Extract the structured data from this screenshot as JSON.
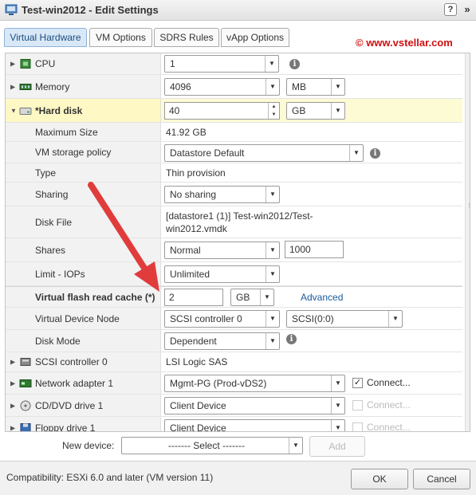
{
  "window": {
    "title": "Test-win2012 - Edit Settings",
    "help": "?",
    "more": "»"
  },
  "tabs": [
    "Virtual Hardware",
    "VM Options",
    "SDRS Rules",
    "vApp Options"
  ],
  "watermark": "© www.vstellar.com",
  "rows": {
    "cpu": {
      "label": "CPU",
      "value": "1"
    },
    "memory": {
      "label": "Memory",
      "value": "4096",
      "unit": "MB"
    },
    "harddisk": {
      "label": "*Hard disk",
      "value": "40",
      "unit": "GB"
    },
    "maxsize": {
      "label": "Maximum Size",
      "value": "41.92 GB"
    },
    "policy": {
      "label": "VM storage policy",
      "value": "Datastore Default"
    },
    "type": {
      "label": "Type",
      "value": "Thin provision"
    },
    "sharing": {
      "label": "Sharing",
      "value": "No sharing"
    },
    "diskfile": {
      "label": "Disk File",
      "line1": "[datastore1 (1)] Test-win2012/Test-",
      "line2": "win2012.vmdk"
    },
    "shares": {
      "label": "Shares",
      "value": "Normal",
      "amount": "1000"
    },
    "limit": {
      "label": "Limit - IOPs",
      "value": "Unlimited"
    },
    "vflash": {
      "label": "Virtual flash read cache (*)",
      "value": "2",
      "unit": "GB",
      "link": "Advanced"
    },
    "vdn": {
      "label": "Virtual Device Node",
      "controller": "SCSI controller 0",
      "node": "SCSI(0:0)"
    },
    "diskmode": {
      "label": "Disk Mode",
      "value": "Dependent"
    },
    "scsi": {
      "label": "SCSI controller 0",
      "value": "LSI Logic SAS"
    },
    "network": {
      "label": "Network adapter 1",
      "value": "Mgmt-PG (Prod-vDS2)",
      "connect": "Connect...",
      "checked": true
    },
    "cddvd": {
      "label": "CD/DVD drive 1",
      "value": "Client Device",
      "connect": "Connect...",
      "checked": false
    },
    "floppy": {
      "label": "Floppy drive 1",
      "value": "Client Device",
      "connect": "Connect...",
      "checked": false
    }
  },
  "newdevice": {
    "label": "New device:",
    "value": "------- Select -------",
    "add": "Add"
  },
  "footer": {
    "compat": "Compatibility: ESXi 6.0 and later (VM version 11)",
    "ok": "OK",
    "cancel": "Cancel"
  },
  "colors": {
    "accent": "#d9e8f7",
    "highlight": "#fdf8c4",
    "arrow": "#e03c3c",
    "link": "#1a5a9c"
  }
}
